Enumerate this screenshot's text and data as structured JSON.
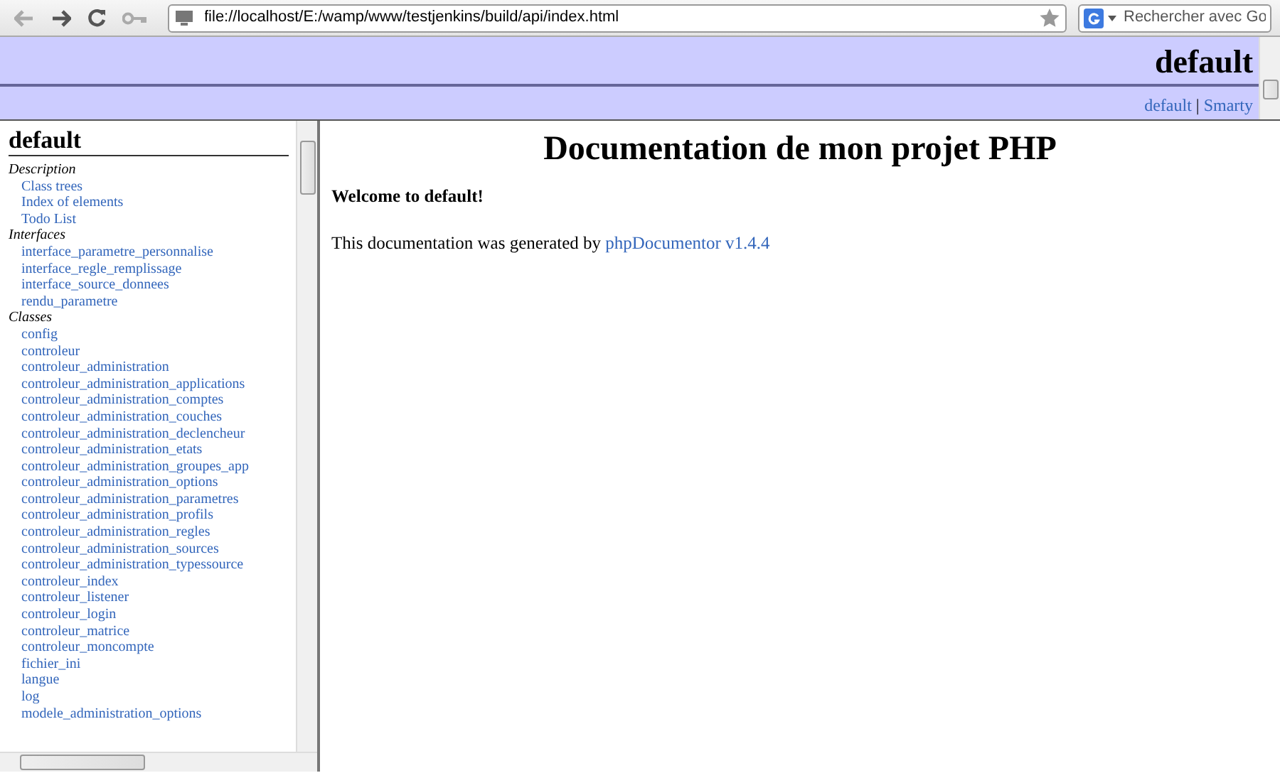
{
  "browser": {
    "url": "file://localhost/E:/wamp/www/testjenkins/build/api/index.html",
    "search": {
      "placeholder": "Rechercher avec Go"
    }
  },
  "header": {
    "title": "default",
    "links": [
      {
        "label": "default"
      },
      {
        "label": "Smarty"
      }
    ],
    "separator": "|"
  },
  "sidebar": {
    "title": "default",
    "sections": [
      {
        "title": "Description",
        "items": [
          "Class trees",
          "Index of elements",
          "Todo List"
        ]
      },
      {
        "title": "Interfaces",
        "items": [
          "interface_parametre_personnalise",
          "interface_regle_remplissage",
          "interface_source_donnees",
          "rendu_parametre"
        ]
      },
      {
        "title": "Classes",
        "items": [
          "config",
          "controleur",
          "controleur_administration",
          "controleur_administration_applications",
          "controleur_administration_comptes",
          "controleur_administration_couches",
          "controleur_administration_declencheur",
          "controleur_administration_etats",
          "controleur_administration_groupes_app",
          "controleur_administration_options",
          "controleur_administration_parametres",
          "controleur_administration_profils",
          "controleur_administration_regles",
          "controleur_administration_sources",
          "controleur_administration_typessource",
          "controleur_index",
          "controleur_listener",
          "controleur_login",
          "controleur_matrice",
          "controleur_moncompte",
          "fichier_ini",
          "langue",
          "log",
          "modele_administration_options"
        ]
      }
    ]
  },
  "main": {
    "title": "Documentation de mon projet PHP",
    "welcome": "Welcome to default!",
    "generated_text": "This documentation was generated by ",
    "generator_link": "phpDocumentor v1.4.4"
  }
}
